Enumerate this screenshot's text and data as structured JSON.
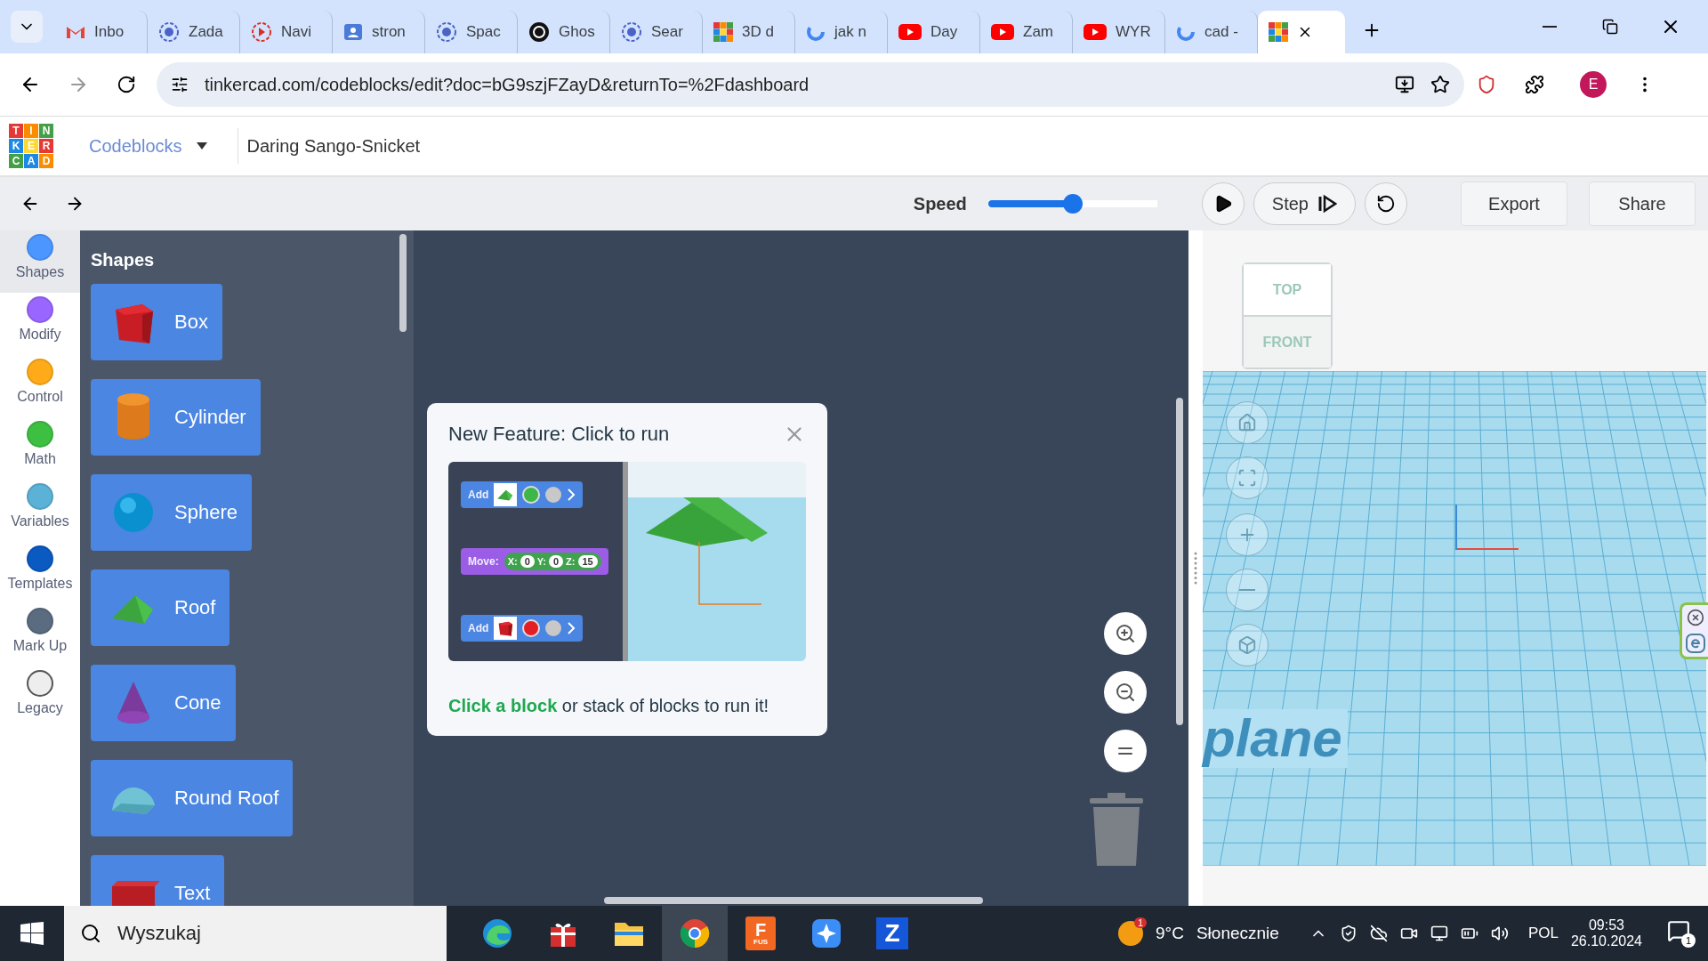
{
  "browser": {
    "tabs": [
      {
        "title": "Inbo",
        "kind": "mail",
        "selected": false
      },
      {
        "title": "Zada",
        "kind": "ring",
        "selected": false
      },
      {
        "title": "Navi",
        "kind": "ring-play",
        "selected": false
      },
      {
        "title": "stron",
        "kind": "card",
        "selected": false
      },
      {
        "title": "Spac",
        "kind": "ring",
        "selected": false
      },
      {
        "title": "Ghos",
        "kind": "dark",
        "selected": false
      },
      {
        "title": "Sear",
        "kind": "ring",
        "selected": false
      },
      {
        "title": "3D d",
        "kind": "grid",
        "selected": false
      },
      {
        "title": "jak n",
        "kind": "g",
        "selected": false
      },
      {
        "title": "Day",
        "kind": "play",
        "selected": false
      },
      {
        "title": "Zam",
        "kind": "play",
        "selected": false
      },
      {
        "title": "WYR",
        "kind": "play",
        "selected": false
      },
      {
        "title": "cad -",
        "kind": "g",
        "selected": false
      },
      {
        "kind": "grid",
        "selected": true
      }
    ],
    "url": "tinkercad.com/codeblocks/edit?doc=bG9szjFZayD&returnTo=%2Fdashboard",
    "profile": "E"
  },
  "header": {
    "logo": [
      "T",
      "I",
      "N",
      "K",
      "E",
      "R",
      "C",
      "A",
      "D"
    ],
    "mode": "Codeblocks",
    "project": "Daring Sango-Snicket"
  },
  "toolbar": {
    "speed_label": "Speed",
    "speed": {
      "level": 0.5
    },
    "step": "Step",
    "export": "Export",
    "share": "Share"
  },
  "categories": [
    {
      "label": "Shapes",
      "color": "#4c97ff",
      "selected": true
    },
    {
      "label": "Modify",
      "color": "#9966ff",
      "selected": false
    },
    {
      "label": "Control",
      "color": "#ffab19",
      "selected": false
    },
    {
      "label": "Math",
      "color": "#3dbf42",
      "selected": false
    },
    {
      "label": "Variables",
      "color": "#5cb1d6",
      "selected": false
    },
    {
      "label": "Templates",
      "color": "#0b5ac2",
      "selected": false
    },
    {
      "label": "Mark Up",
      "color": "#5b6b80",
      "selected": false
    },
    {
      "label": "Legacy",
      "color": "#eeeeee",
      "selected": false
    }
  ],
  "flyout": {
    "title": "Shapes",
    "blocks": [
      {
        "label": "Box",
        "kind": "box"
      },
      {
        "label": "Cylinder",
        "kind": "cylinder"
      },
      {
        "label": "Sphere",
        "kind": "sphere"
      },
      {
        "label": "Roof",
        "kind": "roof"
      },
      {
        "label": "Cone",
        "kind": "cone"
      },
      {
        "label": "Round Roof",
        "kind": "round-roof"
      },
      {
        "label": "Text",
        "kind": "text"
      }
    ]
  },
  "popup": {
    "title": "New Feature: Click to run",
    "text": "**Click a block** or stack of blocks to run it!",
    "demo_blocks": [
      {
        "kind": "add-roof",
        "label": "Add",
        "color": "#3fb648"
      },
      {
        "kind": "move",
        "label": "Move:",
        "fields": [
          {
            "axis": "X:",
            "value": "0"
          },
          {
            "axis": "Y:",
            "value": "0"
          },
          {
            "axis": "Z:",
            "value": "15"
          }
        ]
      },
      {
        "kind": "add-box",
        "label": "Add",
        "color": "#e31e24"
      }
    ]
  },
  "viewport": {
    "viewcube": {
      "top": "TOP",
      "front": "FRONT"
    },
    "plane_label": "plane"
  },
  "taskbar": {
    "search": {
      "placeholder": "Wyszukaj"
    },
    "apps": [
      {
        "kind": "edge",
        "selected": false
      },
      {
        "kind": "gift",
        "selected": false
      },
      {
        "kind": "folder",
        "selected": false
      },
      {
        "kind": "chrome",
        "selected": true
      },
      {
        "kind": "fusion",
        "label": "F",
        "sublabel": "FUS",
        "selected": false
      },
      {
        "kind": "star",
        "selected": false
      },
      {
        "kind": "z",
        "label": "Z",
        "selected": false
      }
    ],
    "weather": {
      "badge": "1",
      "temp": "9°C",
      "condition": "Słonecznie"
    },
    "language": "POL",
    "time": "09:53",
    "date": "26.10.2024",
    "notifications": "1"
  }
}
